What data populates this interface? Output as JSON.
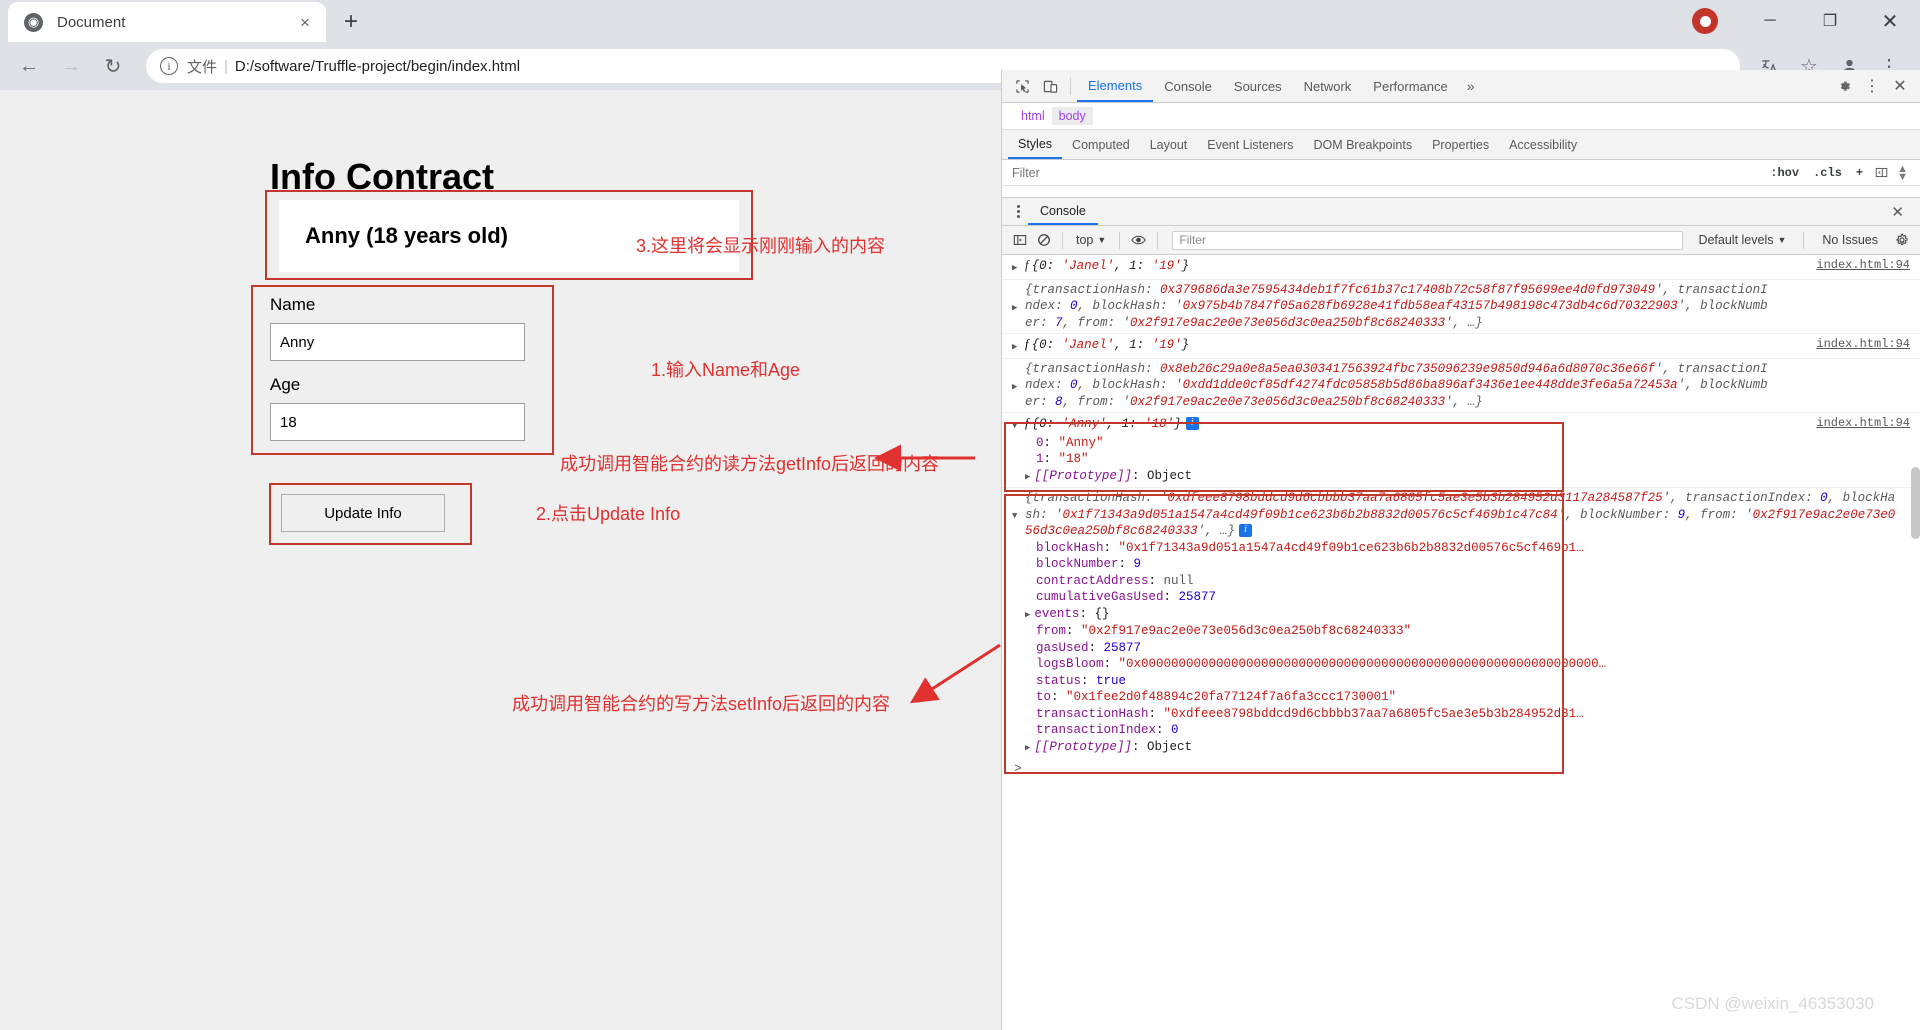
{
  "browser": {
    "tab": {
      "title": "Document",
      "close_label": "×",
      "favicon": "globe-icon"
    },
    "new_tab_label": "+",
    "window_controls": {
      "minimize": "─",
      "maximize": "❐",
      "close": "✕"
    },
    "nav": {
      "back": "←",
      "forward": "→",
      "reload": "↻"
    },
    "omnibox": {
      "info_icon": "i",
      "scheme_label": "文件",
      "separator": "|",
      "url": "D:/software/Truffle-project/begin/index.html"
    },
    "toolbar_right": {
      "translate": "translate-icon",
      "bookmark": "☆",
      "profile": "avatar-icon",
      "menu": "⋮"
    }
  },
  "page": {
    "title": "Info Contract",
    "display_value": "Anny (18 years old)",
    "fields": [
      {
        "label": "Name",
        "value": "Anny"
      },
      {
        "label": "Age",
        "value": "18"
      }
    ],
    "button_label": "Update Info"
  },
  "annotations": [
    {
      "id": "note-3",
      "text": "3.这里将会显示刚刚输入的内容"
    },
    {
      "id": "note-1",
      "text": "1.输入Name和Age"
    },
    {
      "id": "note-getinfo",
      "text": "成功调用智能合约的读方法getInfo后返回的内容"
    },
    {
      "id": "note-2",
      "text": "2.点击Update Info"
    },
    {
      "id": "note-setinfo",
      "text": "成功调用智能合约的写方法setInfo后返回的内容"
    }
  ],
  "devtools": {
    "toolbar": {
      "inspect_icon": "cursor-select-icon",
      "device_icon": "device-toolbar-icon",
      "tabs": [
        {
          "label": "Elements",
          "active": true
        },
        {
          "label": "Console",
          "active": false
        },
        {
          "label": "Sources",
          "active": false
        },
        {
          "label": "Network",
          "active": false
        },
        {
          "label": "Performance",
          "active": false
        }
      ],
      "more_label": "»",
      "settings_icon": "gear-icon",
      "kebab_icon": "⋮",
      "close_icon": "✕"
    },
    "breadcrumbs": [
      "html",
      "body"
    ],
    "styles_tabs": [
      {
        "label": "Styles",
        "active": true
      },
      {
        "label": "Computed",
        "active": false
      },
      {
        "label": "Layout",
        "active": false
      },
      {
        "label": "Event Listeners",
        "active": false
      },
      {
        "label": "DOM Breakpoints",
        "active": false
      },
      {
        "label": "Properties",
        "active": false
      },
      {
        "label": "Accessibility",
        "active": false
      }
    ],
    "styles_filter_placeholder": "Filter",
    "styles_filter_actions": {
      "hov": ":hov",
      "cls": ".cls",
      "plus": "+",
      "newstyle": "◃‖"
    },
    "console_panel": {
      "tab_label": "Console",
      "close_label": "✕",
      "sidebar_icon": "console-sidebar-icon",
      "clear_icon": "clear-console-icon",
      "context": "top",
      "eye_icon": "live-expression-icon",
      "filter_placeholder": "Filter",
      "levels": "Default levels",
      "issues": "No Issues",
      "settings_icon": "gear-icon",
      "prompt": ">"
    },
    "logs": [
      {
        "id": "log-1",
        "type": "object-preview",
        "collapsed": true,
        "source": "index.html:94",
        "parts": [
          {
            "t": "f ",
            "c": "ital-dark"
          },
          {
            "t": "{0: ",
            "c": "dark"
          },
          {
            "t": "'Janel'",
            "c": "str"
          },
          {
            "t": ", 1: ",
            "c": "dark"
          },
          {
            "t": "'19'",
            "c": "str"
          },
          {
            "t": "}",
            "c": "dark"
          }
        ]
      },
      {
        "id": "log-2",
        "type": "tx-receipt",
        "collapsed": true,
        "source": "",
        "transactionHash": "0x379686da3e7595434deb1f7fc61b37c17408b72c58f87f95699ee4d0fd973049",
        "transactionIndex": "0",
        "blockHash": "0x975b4b7847f05a628fb6928e41fdb58eaf43157b498198c473db4c6d70322903",
        "blockNumber": "7",
        "from": "0x2f917e9ac2e0e73e056d3c0ea250bf8c68240333",
        "ellipsis": "…}"
      },
      {
        "id": "log-3",
        "type": "object-preview",
        "collapsed": true,
        "source": "index.html:94",
        "parts": [
          {
            "t": "f ",
            "c": "ital-dark"
          },
          {
            "t": "{0: ",
            "c": "dark"
          },
          {
            "t": "'Janel'",
            "c": "str"
          },
          {
            "t": ", 1: ",
            "c": "dark"
          },
          {
            "t": "'19'",
            "c": "str"
          },
          {
            "t": "}",
            "c": "dark"
          }
        ]
      },
      {
        "id": "log-4",
        "type": "tx-receipt",
        "collapsed": true,
        "source": "",
        "transactionHash": "0x8eb26c29a0e8a5ea0303417563924fbc735096239e9850d946a6d8070c36e66f",
        "transactionIndex": "0",
        "blockHash": "0xdd1dde0cf85df4274fdc05858b5d86ba896af3436e1ee448dde3fe6a5a72453a",
        "blockNumber": "8",
        "from": "0x2f917e9ac2e0e73e056d3c0ea250bf8c68240333",
        "ellipsis": "…}"
      },
      {
        "id": "log-5",
        "type": "object-expanded",
        "collapsed": false,
        "source": "index.html:94",
        "header_parts": [
          {
            "t": "f ",
            "c": "ital-dark"
          },
          {
            "t": "{0: ",
            "c": "dark"
          },
          {
            "t": "'Anny'",
            "c": "str"
          },
          {
            "t": ", 1: ",
            "c": "dark"
          },
          {
            "t": "'18'",
            "c": "str"
          },
          {
            "t": "}",
            "c": "dark"
          }
        ],
        "children": [
          {
            "key": "0",
            "value": "\"Anny\"",
            "kind": "string"
          },
          {
            "key": "1",
            "value": "\"18\"",
            "kind": "string"
          },
          {
            "key": "[[Prototype]]",
            "value": "Object",
            "kind": "proto"
          }
        ]
      },
      {
        "id": "log-6",
        "type": "tx-receipt-expanded",
        "collapsed": false,
        "source": "",
        "transactionHash": "0xdfeee8798bddcd9d6cbbbb37aa7a6805fc5ae3e5b3b284952d3117a284587f25",
        "transactionIndex": "0",
        "blockHash": "0x1f71343a9d051a1547a4cd49f09b1ce623b6b2b8832d00576c5cf469b1c47c84",
        "blockNumber": "9",
        "from": "0x2f917e9ac2e0e73e056d3c0ea250bf8c68240333",
        "ellipsis": "…}",
        "children": [
          {
            "key": "blockHash",
            "value": "\"0x1f71343a9d051a1547a4cd49f09b1ce623b6b2b8832d00576c5cf469b1…",
            "kind": "string"
          },
          {
            "key": "blockNumber",
            "value": "9",
            "kind": "number"
          },
          {
            "key": "contractAddress",
            "value": "null",
            "kind": "null"
          },
          {
            "key": "cumulativeGasUsed",
            "value": "25877",
            "kind": "number"
          },
          {
            "key": "events",
            "value": "{}",
            "kind": "object",
            "expandable": true
          },
          {
            "key": "from",
            "value": "\"0x2f917e9ac2e0e73e056d3c0ea250bf8c68240333\"",
            "kind": "string"
          },
          {
            "key": "gasUsed",
            "value": "25877",
            "kind": "number"
          },
          {
            "key": "logsBloom",
            "value": "\"0x0000000000000000000000000000000000000000000000000000000000000…",
            "kind": "string"
          },
          {
            "key": "status",
            "value": "true",
            "kind": "bool"
          },
          {
            "key": "to",
            "value": "\"0x1fee2d0f48894c20fa77124f7a6fa3ccc1730001\"",
            "kind": "string"
          },
          {
            "key": "transactionHash",
            "value": "\"0xdfeee8798bddcd9d6cbbbb37aa7a6805fc5ae3e5b3b284952d31…",
            "kind": "string"
          },
          {
            "key": "transactionIndex",
            "value": "0",
            "kind": "number"
          },
          {
            "key": "[[Prototype]]",
            "value": "Object",
            "kind": "proto"
          }
        ]
      }
    ]
  },
  "watermark": "CSDN @weixin_46353030",
  "colors": {
    "annotation_red": "#e03030",
    "box_red": "#c0392b",
    "devtools_accent": "#1a73e8",
    "string_red": "#c41a16",
    "number_blue": "#1c00cf",
    "key_purple": "#881391"
  }
}
